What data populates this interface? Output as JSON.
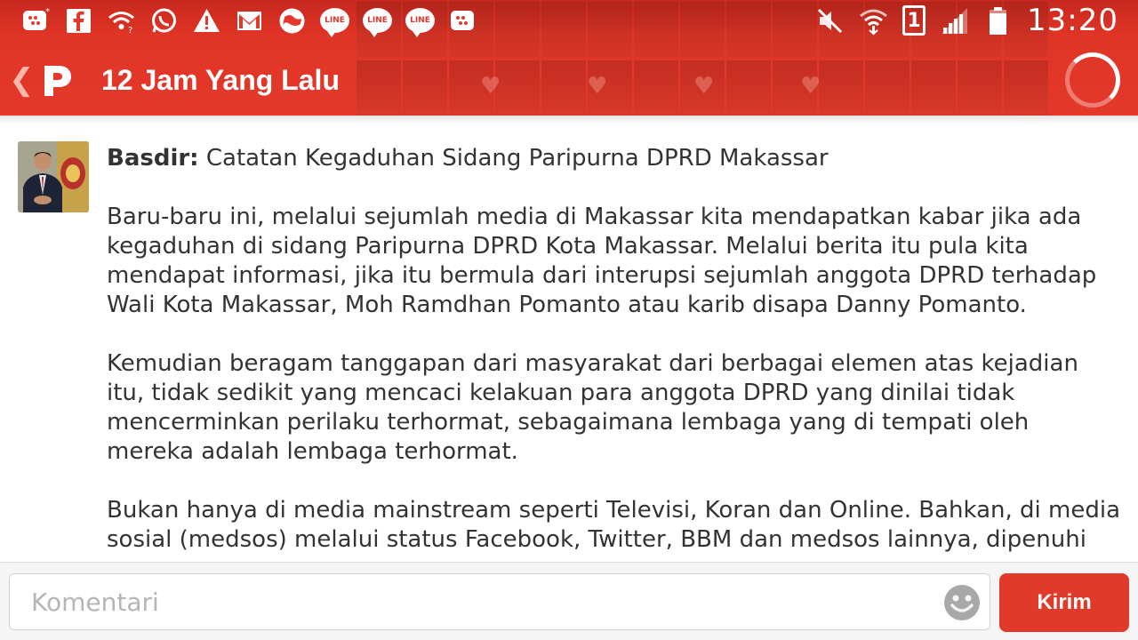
{
  "statusbar": {
    "time": "13:20",
    "sim_slot": "1",
    "line_label": "LINE",
    "notification_icons": [
      "bbm-icon",
      "facebook-icon",
      "wifi-notification-icon",
      "whatsapp-icon",
      "warning-icon",
      "gmail-icon",
      "browser-globe-icon",
      "line-icon",
      "line-icon",
      "line-icon",
      "bbm-icon"
    ],
    "system_icons": [
      "mute-icon",
      "wifi-icon",
      "sim-1-icon",
      "signal-icon",
      "battery-icon"
    ]
  },
  "actionbar": {
    "title": "12 Jam Yang Lalu"
  },
  "post": {
    "author": "Basdir:",
    "headline": "Catatan Kegaduhan Sidang Paripurna DPRD Makassar",
    "paragraphs": [
      "Baru-baru ini, melalui sejumlah media di Makassar kita mendapatkan kabar jika ada kegaduhan di sidang Paripurna DPRD Kota Makassar. Melalui berita itu pula kita mendapat informasi, jika itu bermula dari interupsi sejumlah anggota DPRD terhadap Wali Kota Makassar, Moh Ramdhan Pomanto atau karib disapa Danny Pomanto.",
      "Kemudian beragam tanggapan dari masyarakat dari berbagai elemen atas kejadian itu, tidak sedikit yang mencaci kelakuan para anggota DPRD yang dinilai tidak mencerminkan perilaku terhormat, sebagaimana lembaga yang di tempati oleh mereka adalah lembaga terhormat.",
      "Bukan hanya di media mainstream seperti Televisi, Koran dan Online. Bahkan, di media sosial (medsos) melalui status Facebook, Twitter, BBM dan medsos lainnya, dipenuhi"
    ]
  },
  "comment": {
    "placeholder": "Komentari",
    "send_label": "Kirim"
  },
  "colors": {
    "header_red": "#e4392a",
    "send_button": "#e23a2a",
    "text": "#333333"
  }
}
